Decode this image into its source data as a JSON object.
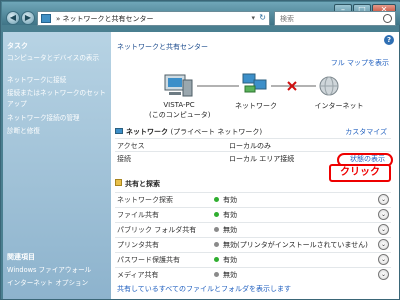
{
  "window": {
    "controls": {
      "minimize": "–",
      "maximize": "□",
      "close": "✕"
    }
  },
  "address_bar": {
    "back": "◀",
    "forward": "▶",
    "path": "» ネットワークと共有センター",
    "dropdown": "▾",
    "refresh": "↻",
    "search_placeholder": "検索"
  },
  "sidebar": {
    "heading": "タスク",
    "tasks": [
      "コンピュータとデバイスの表示",
      "ネットワークに接続",
      "接続またはネットワークのセットアップ",
      "ネットワーク接続の管理",
      "診断と修復"
    ],
    "see_also_heading": "関連項目",
    "see_also": [
      "Windows ファイアウォール",
      "インターネット オプション"
    ]
  },
  "main": {
    "help": "?",
    "title": "ネットワークと共有センター",
    "full_map": "フル マップを表示",
    "map": {
      "computer": "VISTA-PC",
      "computer_sub": "(このコンピュータ)",
      "network": "ネットワーク",
      "internet": "インターネット"
    },
    "network_section": {
      "title": "ネットワーク",
      "subtitle": "(プライベート ネットワーク)",
      "customize": "カスタマイズ",
      "rows": [
        {
          "label": "アクセス",
          "value": "ローカルのみ"
        },
        {
          "label": "接続",
          "value": "ローカル エリア接続",
          "link": "状態の表示"
        }
      ]
    },
    "callout": "クリック",
    "sharing_section": {
      "title": "共有と探索",
      "rows": [
        {
          "label": "ネットワーク探索",
          "value": "有効",
          "status": "on"
        },
        {
          "label": "ファイル共有",
          "value": "有効",
          "status": "on"
        },
        {
          "label": "パブリック フォルダ共有",
          "value": "無効",
          "status": "off"
        },
        {
          "label": "プリンタ共有",
          "value": "無効(プリンタがインストールされていません)",
          "status": "off"
        },
        {
          "label": "パスワード保護共有",
          "value": "有効",
          "status": "on"
        },
        {
          "label": "メディア共有",
          "value": "無効",
          "status": "off"
        }
      ]
    },
    "bottom_link": "共有しているすべてのファイルとフォルダを表示します"
  },
  "colors": {
    "on": "#2fae2f",
    "off": "#8a8a8a",
    "link": "#1f5fbf",
    "callout": "#e00000"
  }
}
